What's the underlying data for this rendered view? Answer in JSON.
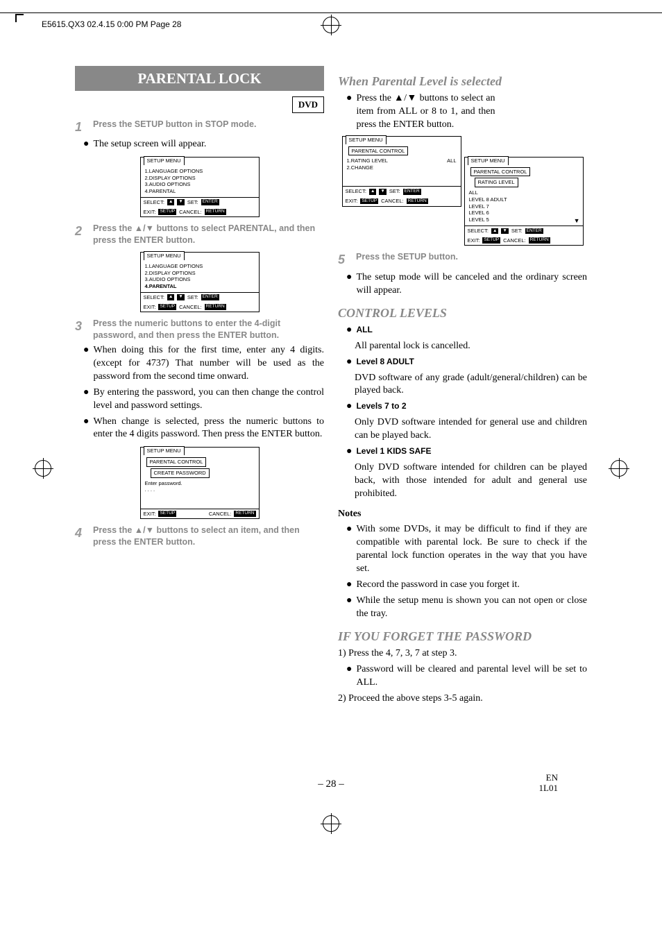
{
  "header": {
    "job": "E5615.QX3  02.4.15 0:00 PM  Page 28"
  },
  "title": "PARENTAL LOCK",
  "dvd": "DVD",
  "steps": {
    "s1": {
      "n": "1",
      "t": "Press the SETUP button in STOP mode."
    },
    "s1b": "The setup screen will appear.",
    "s2": {
      "n": "2",
      "t": "Press the ▲/▼ buttons to select PARENTAL, and then press the ENTER button."
    },
    "s3": {
      "n": "3",
      "t": "Press the numeric buttons to enter the 4-digit password, and then press the ENTER button."
    },
    "s3b": [
      "When doing this for the first time, enter any 4 digits. (except for 4737) That number will be used as the password from the second time onward.",
      "By entering the password, you can then change the control level and password settings.",
      "When change is selected, press the numeric buttons to enter the 4 digits password. Then press the ENTER button."
    ],
    "s4": {
      "n": "4",
      "t": "Press the ▲/▼ buttons to select an item, and then press the ENTER button."
    },
    "s5": {
      "n": "5",
      "t": "Press the SETUP button."
    },
    "s5b": "The setup mode will be canceled and the ordinary screen will appear."
  },
  "right": {
    "whenHead": "When Parental Level is selected",
    "whenP": "Press the ▲/▼ buttons to select an item from ALL or 8 to 1, and then press the ENTER button.",
    "ctlHead": "CONTROL LEVELS",
    "all": {
      "h": "ALL",
      "p": "All parental lock is cancelled."
    },
    "l8": {
      "h": "Level 8 ADULT",
      "p": "DVD software of any grade (adult/general/children) can be played back."
    },
    "l72": {
      "h": "Levels 7 to 2",
      "p": "Only DVD software intended for general use and children can be played back."
    },
    "l1": {
      "h": "Level 1 KIDS SAFE",
      "p": "Only DVD software intended for children can be played back, with those intended for adult and general use prohibited."
    },
    "notesH": "Notes",
    "notes": [
      "With some DVDs, it may be difficult to find if they are compatible with parental lock. Be sure to check if the parental lock function operates in the way that you have set.",
      "Record the password in case you forget it.",
      "While the setup menu is shown you can not open or close the tray."
    ],
    "forgetH": "IF YOU FORGET THE PASSWORD",
    "forget1": "1) Press the 4, 7, 3, 7 at step 3.",
    "forgetB": "Password will be cleared and parental level will be set to ALL.",
    "forget2": "2) Proceed the above steps 3-5 again."
  },
  "menus": {
    "tab": "SETUP MENU",
    "pc": "PARENTAL CONTROL",
    "rl": "RATING LEVEL",
    "cp": "CREATE PASSWORD",
    "opts": [
      "1.LANGUAGE OPTIONS",
      "2.DISPLAY OPTIONS",
      "3.AUDIO OPTIONS",
      "4.PARENTAL"
    ],
    "pc_items": [
      {
        "l": "1.RATING LEVEL",
        "r": "ALL"
      },
      {
        "l": "2.CHANGE",
        "r": ""
      }
    ],
    "levels": [
      "ALL",
      "LEVEL 8 ADULT",
      "LEVEL 7",
      "LEVEL 6",
      "LEVEL 5"
    ],
    "pwd": "Enter password.",
    "dots": ". . . .",
    "foot": {
      "select": "SELECT:",
      "set": "SET:",
      "exit": "EXIT:",
      "cancel": "CANCEL:",
      "enter": "ENTER",
      "setup": "SETUP",
      "return": "RETURN"
    }
  },
  "footer": {
    "page": "– 28 –",
    "en": "EN",
    "code": "1L01"
  }
}
